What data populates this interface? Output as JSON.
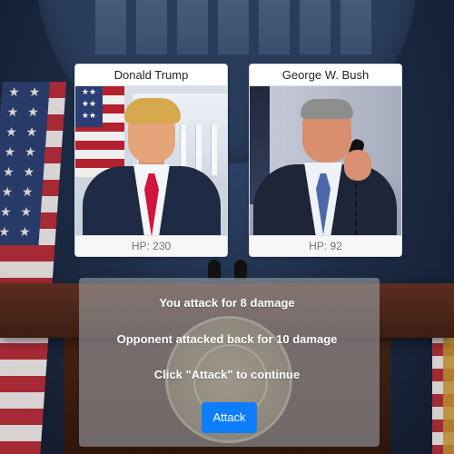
{
  "fighters": {
    "left": {
      "name": "Donald Trump",
      "hp_text": "HP: 230",
      "hp": 230
    },
    "right": {
      "name": "George W. Bush",
      "hp_text": "HP: 92",
      "hp": 92
    }
  },
  "battle_log": {
    "line_1": "You attack for 8 damage",
    "line_2": "Opponent attacked back for 10 damage",
    "line_3": "Click \"Attack\" to continue"
  },
  "controls": {
    "attack_label": "Attack"
  },
  "colors": {
    "accent": "#0d7dfb",
    "panel_overlay": "#a0a5ac",
    "card_background": "#ffffff"
  }
}
